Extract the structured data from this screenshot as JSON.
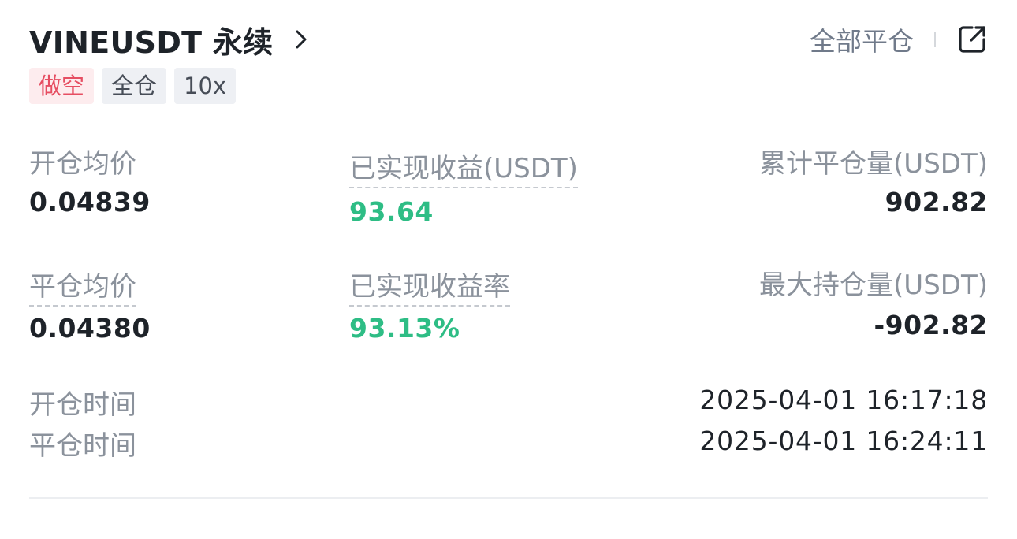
{
  "header": {
    "title": "VINEUSDT 永续",
    "close_all_label": "全部平仓"
  },
  "tags": {
    "side": "做空",
    "margin_mode": "全仓",
    "leverage": "10x"
  },
  "stats": {
    "avg_open_price_label": "开仓均价",
    "avg_open_price": "0.04839",
    "realized_pnl_label": "已实现收益(USDT)",
    "realized_pnl": "93.64",
    "total_closed_volume_label": "累计平仓量(USDT)",
    "total_closed_volume": "902.82",
    "avg_close_price_label": "平仓均价",
    "avg_close_price": "0.04380",
    "realized_pnl_rate_label": "已实现收益率",
    "realized_pnl_rate": "93.13%",
    "max_position_label": "最大持仓量(USDT)",
    "max_position": "-902.82"
  },
  "times": {
    "open_time_label": "开仓时间",
    "open_time": "2025-04-01 16:17:18",
    "close_time_label": "平仓时间",
    "close_time": "2025-04-01 16:24:11"
  },
  "colors": {
    "profit": "#2ebd85",
    "short": "#e64e62",
    "muted": "#8b929c",
    "primary_text": "#1e2329"
  },
  "icons": {
    "title_chevron": "chevron-right-icon",
    "share": "share-external-icon"
  }
}
